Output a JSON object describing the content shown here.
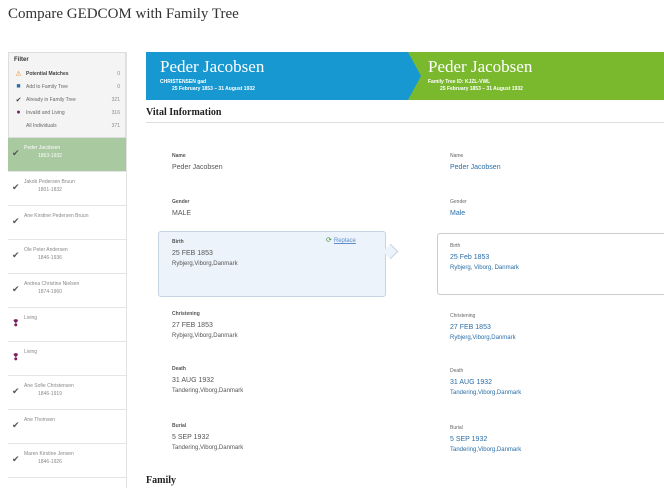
{
  "page_title": "Compare GEDCOM with Family Tree",
  "filter": {
    "title": "Filter",
    "rows": [
      {
        "icon": "warning-icon",
        "glyph": "⚠",
        "color": "#e08a2b",
        "label": "Potential Matches",
        "count": "0",
        "bold": true
      },
      {
        "icon": "add-icon",
        "glyph": "■",
        "color": "#2a6ea8",
        "label": "Add to Family Tree",
        "count": "0",
        "bold": false
      },
      {
        "icon": "check-icon",
        "glyph": "✔",
        "color": "#444",
        "label": "Already in Family Tree",
        "count": "321",
        "bold": false
      },
      {
        "icon": "invalid-icon",
        "glyph": "●",
        "color": "#7a1f5e",
        "label": "Invalid and Living",
        "count": "316",
        "bold": false
      },
      {
        "icon": "none",
        "glyph": "",
        "color": "#888",
        "label": "All Individuals",
        "count": "371",
        "bold": false
      }
    ]
  },
  "people": [
    {
      "name": "Peder Jacobsen",
      "years": "1853-1932",
      "status": "check",
      "active": true
    },
    {
      "name": "Jakob Pedersen Bruun",
      "years": "1801-1832",
      "status": "check",
      "active": false
    },
    {
      "name": "Ane Kirstine Pedersen Bruun",
      "years": "",
      "status": "check",
      "active": false
    },
    {
      "name": "Ole Peter Andersen",
      "years": "1846-1936",
      "status": "check",
      "active": false
    },
    {
      "name": "Andrea Christine Nielsen",
      "years": "1874-1960",
      "status": "check",
      "active": false
    },
    {
      "name": "Living",
      "years": "",
      "status": "warn",
      "active": false
    },
    {
      "name": "Living",
      "years": "",
      "status": "warn",
      "active": false
    },
    {
      "name": "Ane Sofie Christensen",
      "years": "1846-1919",
      "status": "check",
      "active": false
    },
    {
      "name": "Ane Thomsen",
      "years": "",
      "status": "check",
      "active": false
    },
    {
      "name": "Maren Kirstine Jensen",
      "years": "1846-1926",
      "status": "check",
      "active": false
    }
  ],
  "left_header": {
    "name": "Peder Jacobsen",
    "line1": "CHRISTENSEN gad",
    "line2": "25 February 1853 – 31 August 1932",
    "color": "#1798d1"
  },
  "right_header": {
    "name": "Peder Jacobsen",
    "line1": "Family Tree ID: KJZL-VWL",
    "line2": "25 February 1853 – 31 August 1932",
    "color": "#7ab92e"
  },
  "vital_title": "Vital Information",
  "family_title": "Family",
  "replace_label": "Replace",
  "left": {
    "name": {
      "label": "Name",
      "value": "Peder Jacobsen"
    },
    "gender": {
      "label": "Gender",
      "value": "MALE"
    },
    "birth": {
      "label": "Birth",
      "date": "25 FEB 1853",
      "place": "Rybjerg,Viborg,Danmark"
    },
    "christening": {
      "label": "Christening",
      "date": "27 FEB 1853",
      "place": "Rybjerg,Viborg,Danmark"
    },
    "death": {
      "label": "Death",
      "date": "31 AUG 1932",
      "place": "Tandering,Viborg,Danmark"
    },
    "burial": {
      "label": "Burial",
      "date": "5 SEP 1932",
      "place": "Tandering,Viborg,Danmark"
    }
  },
  "right": {
    "name": {
      "label": "Name",
      "value": "Peder Jacobsen"
    },
    "gender": {
      "label": "Gender",
      "value": "Male"
    },
    "birth": {
      "label": "Birth",
      "date": "25 Feb 1853",
      "place": "Rybjerg, Viborg, Danmark"
    },
    "christening": {
      "label": "Christening",
      "date": "27 FEB 1853",
      "place": "Rybjerg,Viborg,Danmark"
    },
    "death": {
      "label": "Death",
      "date": "31 AUG 1932",
      "place": "Tandering,Viborg,Danmark"
    },
    "burial": {
      "label": "Burial",
      "date": "5 SEP 1932",
      "place": "Tandering,Viborg,Danmark"
    }
  }
}
